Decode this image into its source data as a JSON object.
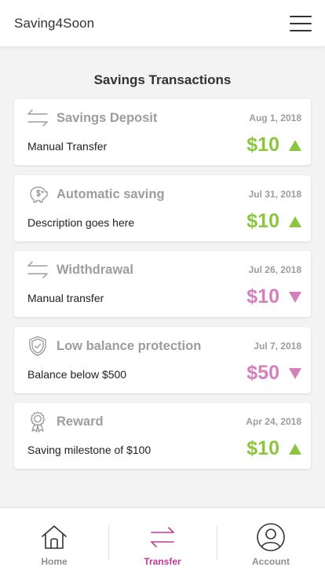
{
  "header": {
    "app_title": "Saving4Soon"
  },
  "main": {
    "section_title": "Savings Transactions",
    "transactions": [
      {
        "title": "Savings Deposit",
        "date": "Aug 1, 2018",
        "description": "Manual Transfer",
        "amount": "$10",
        "direction": "up",
        "icon": "transfer-arrows-icon"
      },
      {
        "title": "Automatic saving",
        "date": "Jul 31, 2018",
        "description": "Description goes here",
        "amount": "$10",
        "direction": "up",
        "icon": "piggy-bank-icon"
      },
      {
        "title": "Widthdrawal",
        "date": "Jul 26, 2018",
        "description": "Manual transfer",
        "amount": "$10",
        "direction": "down",
        "icon": "transfer-arrows-icon"
      },
      {
        "title": "Low balance protection",
        "date": "Jul 7, 2018",
        "description": "Balance below $500",
        "amount": "$50",
        "direction": "down",
        "icon": "shield-check-icon"
      },
      {
        "title": "Reward",
        "date": "Apr 24, 2018",
        "description": "Saving milestone of $100",
        "amount": "$10",
        "direction": "up",
        "icon": "award-ribbon-icon"
      }
    ]
  },
  "tabs": [
    {
      "label": "Home",
      "icon": "home-icon",
      "active": false
    },
    {
      "label": "Transfer",
      "icon": "transfer-arrows-icon",
      "active": true
    },
    {
      "label": "Account",
      "icon": "user-circle-icon",
      "active": false
    }
  ],
  "colors": {
    "positive": "#8cc63e",
    "negative": "#d480bf",
    "accent": "#c03a9b",
    "muted": "#9d9d9d",
    "background": "#f3f3f3"
  }
}
